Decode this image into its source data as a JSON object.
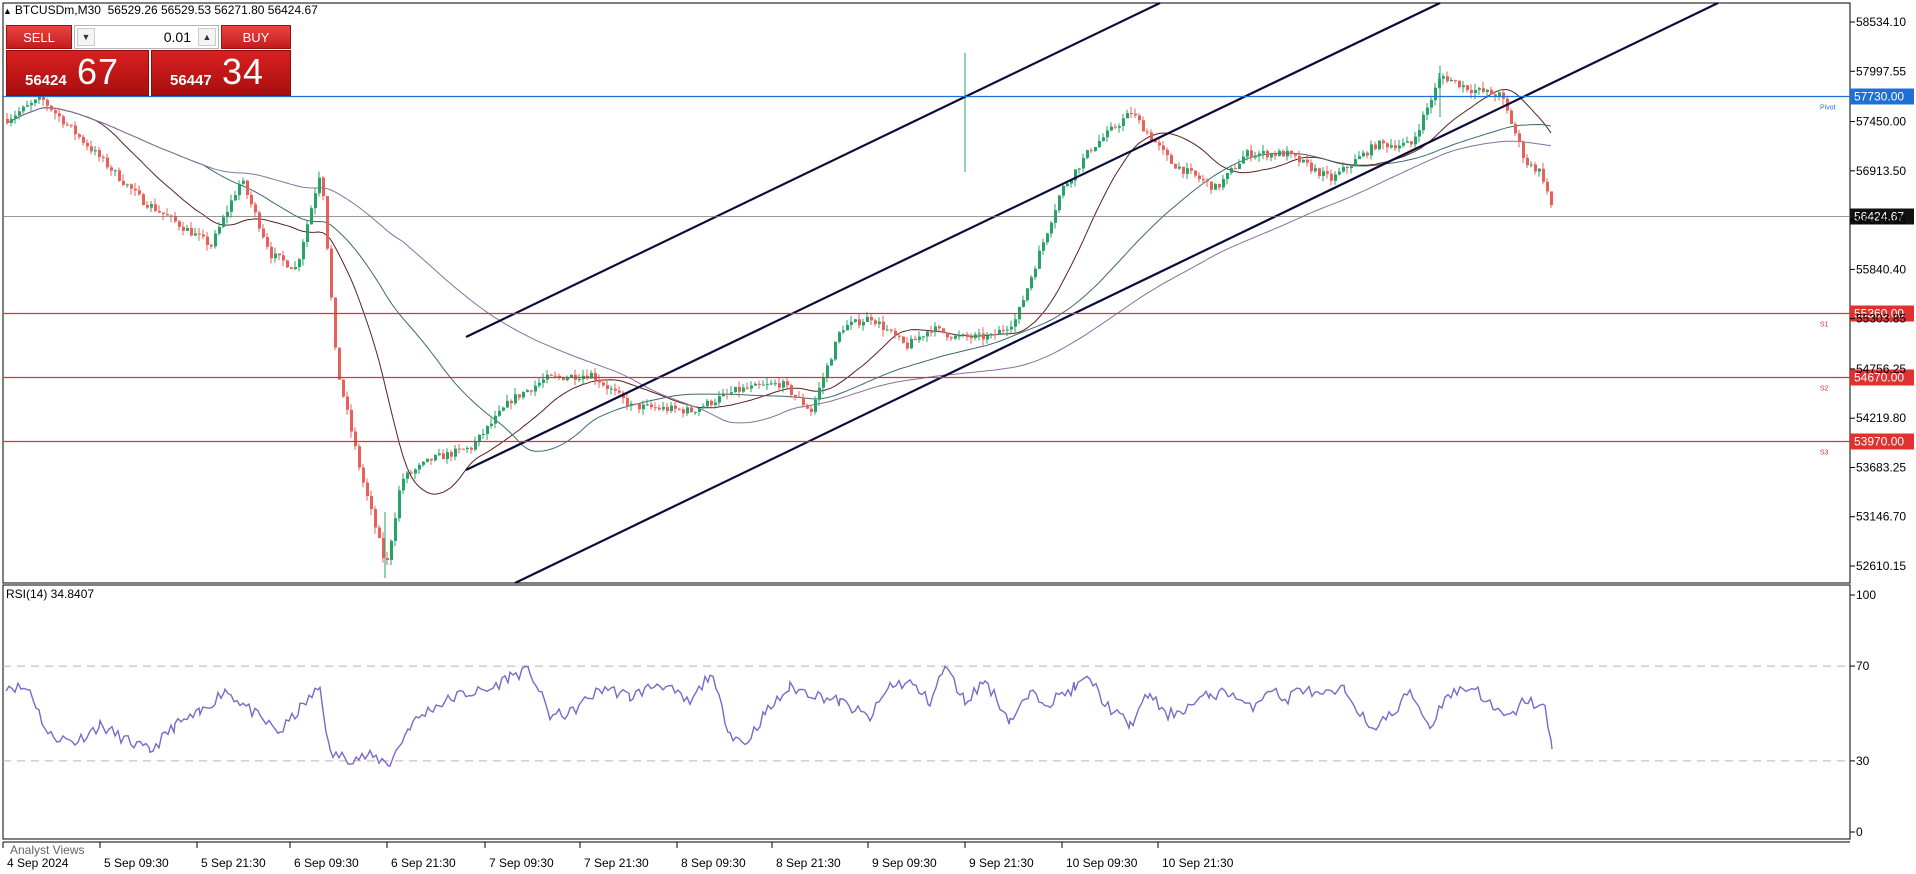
{
  "header": {
    "symbol_tf": "BTCUSDm,M30",
    "ohlc": "56529.26 56529.53 56271.80 56424.67"
  },
  "trade_panel": {
    "sell_label": "SELL",
    "buy_label": "BUY",
    "lot_value": "0.01",
    "sell_price_small": "56424",
    "sell_price_big": "67",
    "buy_price_small": "56447",
    "buy_price_big": "34"
  },
  "price_axis": {
    "labels": [
      "58534.10",
      "57997.55",
      "57450.00",
      "56913.50",
      "56376.95",
      "55840.40",
      "55303.85",
      "54756.25",
      "54219.80",
      "53683.25",
      "53146.70",
      "52610.15"
    ]
  },
  "levels": [
    {
      "name": "Pivot",
      "price": "57730.00",
      "color": "#1e6fd6",
      "tag": "Pivot"
    },
    {
      "name": "S1",
      "price": "55360.00",
      "color": "#e03131",
      "tag": "S1"
    },
    {
      "name": "S2",
      "price": "54670.00",
      "color": "#e03131",
      "tag": "S2"
    },
    {
      "name": "S3",
      "price": "53970.00",
      "color": "#e03131",
      "tag": "S3"
    }
  ],
  "current_price": "56424.67",
  "rsi": {
    "label": "RSI(14) 34.8407",
    "scale": [
      "100",
      "70",
      "30",
      "0"
    ]
  },
  "time_axis": [
    "4 Sep 2024",
    "5 Sep 09:30",
    "5 Sep 21:30",
    "6 Sep 09:30",
    "6 Sep 21:30",
    "7 Sep 09:30",
    "7 Sep 21:30",
    "8 Sep 09:30",
    "8 Sep 21:30",
    "9 Sep 09:30",
    "9 Sep 21:30",
    "10 Sep 09:30",
    "10 Sep 21:30"
  ],
  "footer": {
    "analyst_views": "Analyst Views"
  },
  "colors": {
    "bull": "#27a36a",
    "bear": "#e8605a",
    "rsi_line": "#7b68c9",
    "channel": "#0b0b3b",
    "ma_dark": "#5a2020",
    "ma_teal": "#3d6b6b",
    "ma_purple": "#8a6f9f"
  }
}
